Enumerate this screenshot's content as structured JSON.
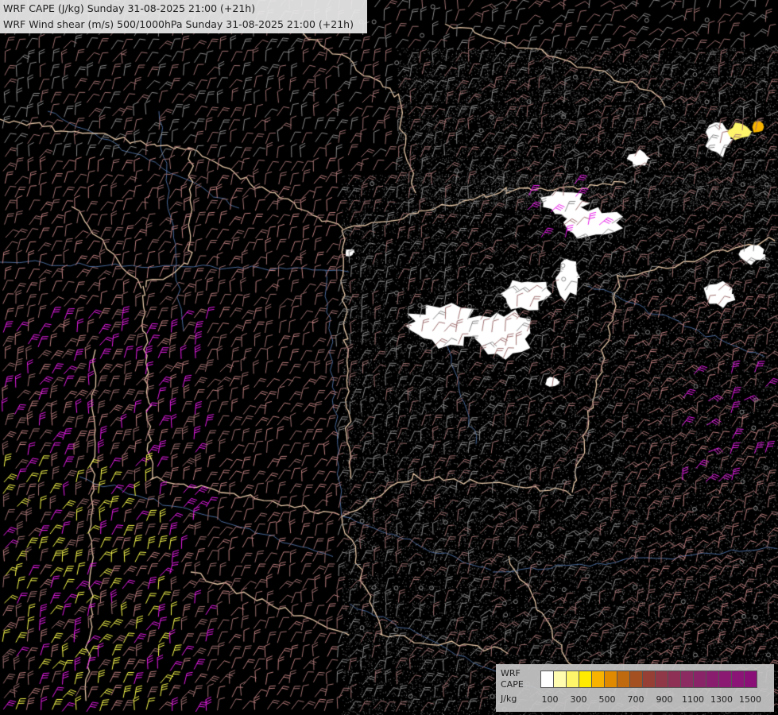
{
  "title": {
    "line1": "WRF CAPE (J/kg) Sunday 31-08-2025 21:00 (+21h)",
    "line2": "WRF Wind shear (m/s) 500/1000hPa Sunday 31-08-2025 21:00 (+21h)"
  },
  "legend": {
    "label1": "WRF",
    "label2": "CAPE",
    "label3": "J/kg",
    "colors": [
      "#ffffff",
      "#fffcb0",
      "#fff56a",
      "#ffea00",
      "#f7b300",
      "#e08a00",
      "#c06a10",
      "#a45020",
      "#964035",
      "#903848",
      "#8e3055",
      "#8c2a62",
      "#8a2468",
      "#8a1e6e",
      "#8a1a72",
      "#8a1576",
      "#8a1078"
    ],
    "ticks": [
      "100",
      "300",
      "500",
      "700",
      "900",
      "1100",
      "1300",
      "1500"
    ]
  },
  "map_layers": {
    "cape_areas": [
      "white",
      "yellow",
      "magenta"
    ],
    "barb_colors": [
      "#8a8a8a",
      "#a07070",
      "#c08080",
      "#e06a9a",
      "#e81ee8",
      "#ffff50"
    ],
    "border_color": "#e8c8a8",
    "river_color": "#4a6a9a"
  }
}
